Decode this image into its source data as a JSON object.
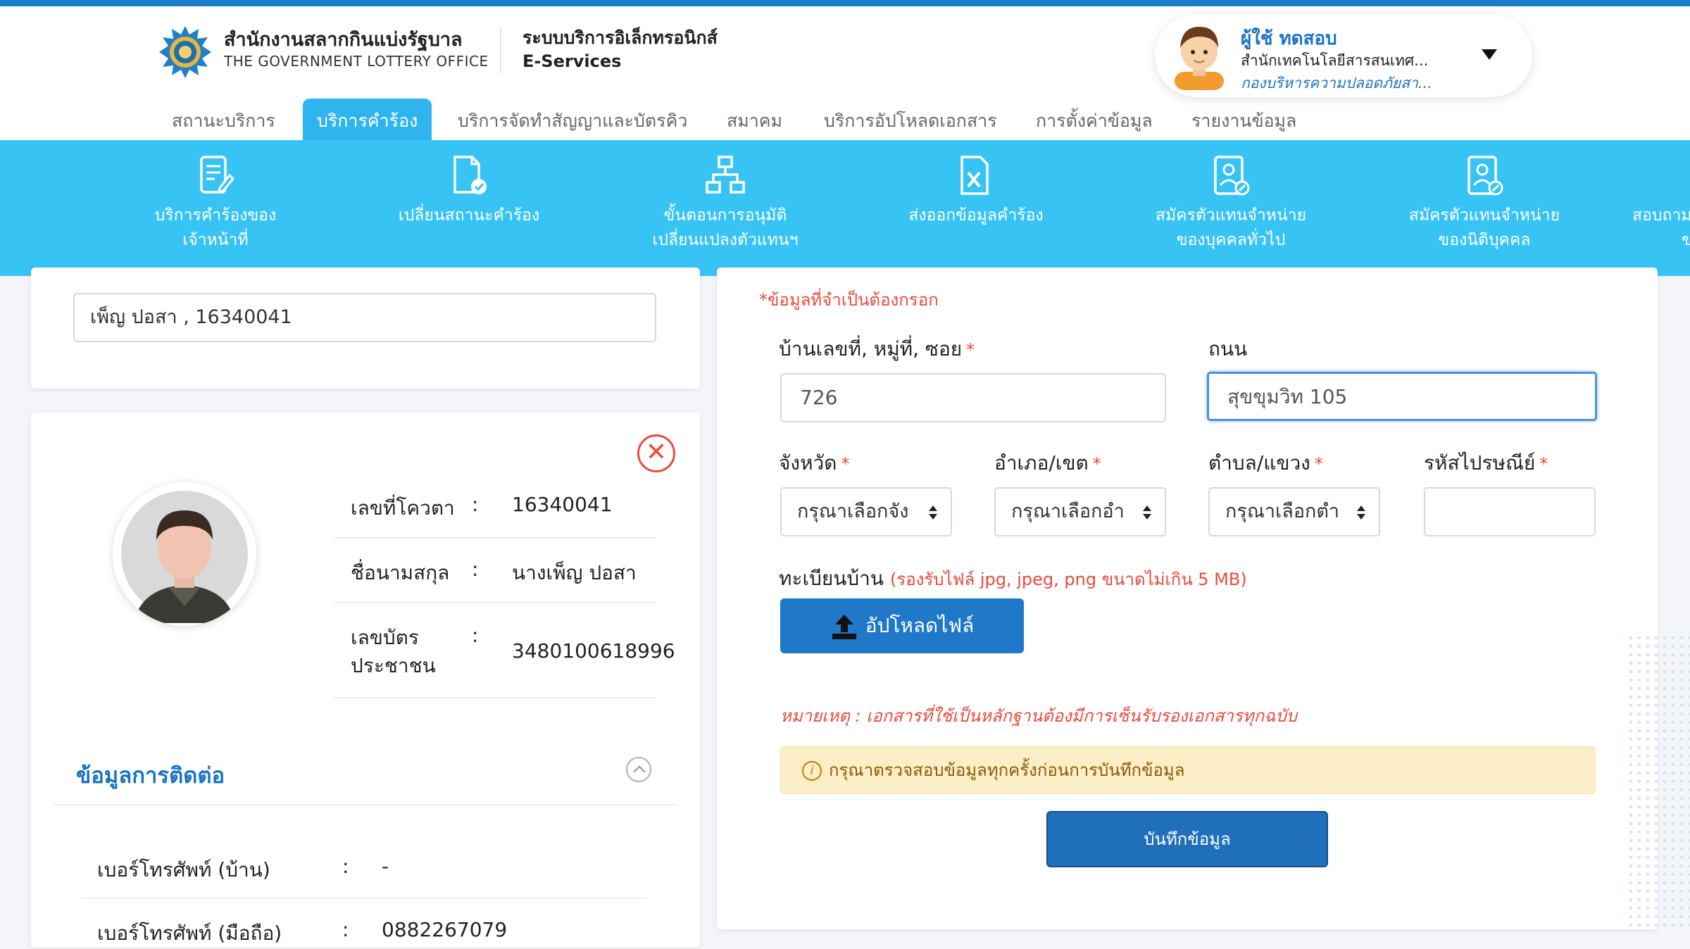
{
  "header": {
    "org_name_th": "สำนักงานสลากกินแบ่งรัฐบาล",
    "org_name_en": "THE GOVERNMENT LOTTERY OFFICE",
    "system_name_th": "ระบบบริการอิเล็กทรอนิกส์",
    "system_name_en": "E-Services",
    "brand_color": "#1a7fc9"
  },
  "user": {
    "name": "ผู้ใช้ ทดสอบ",
    "department": "สำนักเทคโนโลยีสารสนเทศ...",
    "division": "กองบริหารความปลอดภัยสา..."
  },
  "tabs": [
    {
      "label": "สถานะบริการ",
      "active": false
    },
    {
      "label": "บริการคำร้อง",
      "active": true
    },
    {
      "label": "บริการจัดทำสัญญาและบัตรคิว",
      "active": false
    },
    {
      "label": "สมาคม",
      "active": false
    },
    {
      "label": "บริการอัปโหลดเอกสาร",
      "active": false
    },
    {
      "label": "การตั้งค่าข้อมูล",
      "active": false
    },
    {
      "label": "รายงานข้อมูล",
      "active": false
    }
  ],
  "submenu": [
    {
      "line1": "บริการคำร้องของ",
      "line2": "เจ้าหน้าที่",
      "icon": "document-edit-icon",
      "active": true
    },
    {
      "line1": "เปลี่ยนสถานะคำร้อง",
      "line2": "",
      "icon": "document-check-icon",
      "active": false
    },
    {
      "line1": "ขั้นตอนการอนุมัติ",
      "line2": "เปลี่ยนแปลงตัวแทนฯ",
      "icon": "sitemap-icon",
      "active": false
    },
    {
      "line1": "ส่งออกข้อมูลคำร้อง",
      "line2": "",
      "icon": "excel-export-icon",
      "active": false
    },
    {
      "line1": "สมัครตัวแทนจำหน่าย",
      "line2": "ของบุคคลทั่วไป",
      "icon": "person-card-icon",
      "active": false
    },
    {
      "line1": "สมัครตัวแทนจำหน่าย",
      "line2": "ของนิติบุคคล",
      "icon": "person-card-icon",
      "active": false
    },
    {
      "line1": "สอบถาม",
      "line2": "ข",
      "icon": "question-icon",
      "active": false
    }
  ],
  "left": {
    "search_value": "เพ็ญ ปอสา , 16340041",
    "profile": {
      "quota_label": "เลขที่โควตา",
      "quota_value": "16340041",
      "name_label": "ชื่อนามสกุล",
      "name_value": "นางเพ็ญ ปอสา",
      "id_label_line1": "เลขบัตร",
      "id_label_line2": "ประชาชน",
      "id_value": "3480100618996",
      "colon": ":"
    },
    "contact": {
      "title": "ข้อมูลการติดต่อ",
      "home_phone_label": "เบอร์โทรศัพท์ (บ้าน)",
      "home_phone_value": "-",
      "mobile_label": "เบอร์โทรศัพท์ (มือถือ)",
      "mobile_value": "0882267079"
    }
  },
  "form": {
    "required_note": "*ข้อมูลที่จำเป็นต้องกรอก",
    "house_label": "บ้านเลขที่, หมู่ที่, ซอย",
    "house_value": "726",
    "road_label": "ถนน",
    "road_value": "สุขขุมวิท 105",
    "province_label": "จังหวัด",
    "province_placeholder": "กรุณาเลือกจัง",
    "district_label": "อำเภอ/เขต",
    "district_placeholder": "กรุณาเลือกอำ",
    "subdistrict_label": "ตำบล/แขวง",
    "subdistrict_placeholder": "กรุณาเลือกตำ",
    "postcode_label": "รหัสไปรษณีย์",
    "postcode_value": "",
    "required_star": "*",
    "house_reg_label": "ทะเบียนบ้าน",
    "upload_hint": "(รองรับไฟล์ jpg, jpeg, png ขนาดไม่เกิน 5 MB)",
    "upload_button": "อัปโหลดไฟล์",
    "remark": "หมายเหตุ : เอกสารที่ใช้เป็นหลักฐานต้องมีการเซ็นรับรองเอกสารทุกฉบับ",
    "alert": "กรุณาตรวจสอบข้อมูลทุกครั้งก่อนการบันทึกข้อมูล",
    "save_button": "บันทึกข้อมูล"
  }
}
